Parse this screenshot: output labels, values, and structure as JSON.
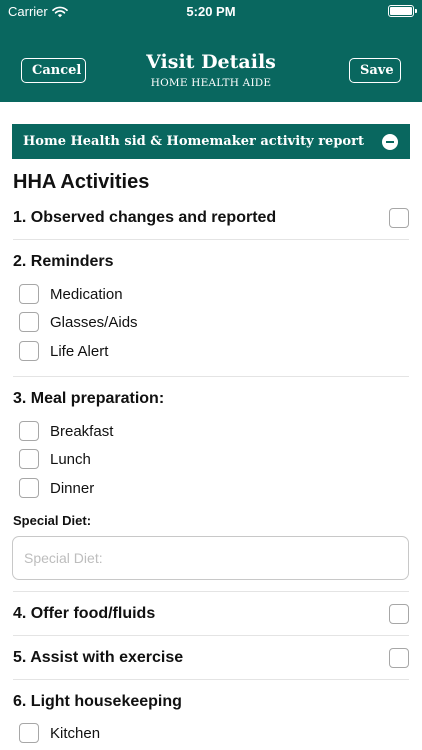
{
  "status_bar": {
    "carrier": "Carrier",
    "time": "5:20 PM"
  },
  "nav": {
    "cancel_label": "Cancel",
    "title": "Visit Details",
    "subtitle": "HOME HEALTH AIDE",
    "save_label": "Save"
  },
  "section": {
    "title": "Home Health sid & Homemaker activity report"
  },
  "activities": {
    "heading": "HHA Activities",
    "q1": "1. Observed changes and reported",
    "q2": "2. Reminders",
    "q2_options": [
      "Medication",
      "Glasses/Aids",
      "Life Alert"
    ],
    "q3": "3. Meal preparation:",
    "q3_options": [
      "Breakfast",
      "Lunch",
      "Dinner"
    ],
    "special_diet_label": "Special Diet:",
    "special_diet_placeholder": "Special Diet:",
    "special_diet_value": "",
    "q4": "4. Offer food/fluids",
    "q5": "5. Assist with exercise",
    "q6": "6. Light housekeeping",
    "q6_options": [
      "Kitchen"
    ]
  },
  "colors": {
    "brand": "#09675f",
    "checkbox_border": "#a7a7a7"
  }
}
